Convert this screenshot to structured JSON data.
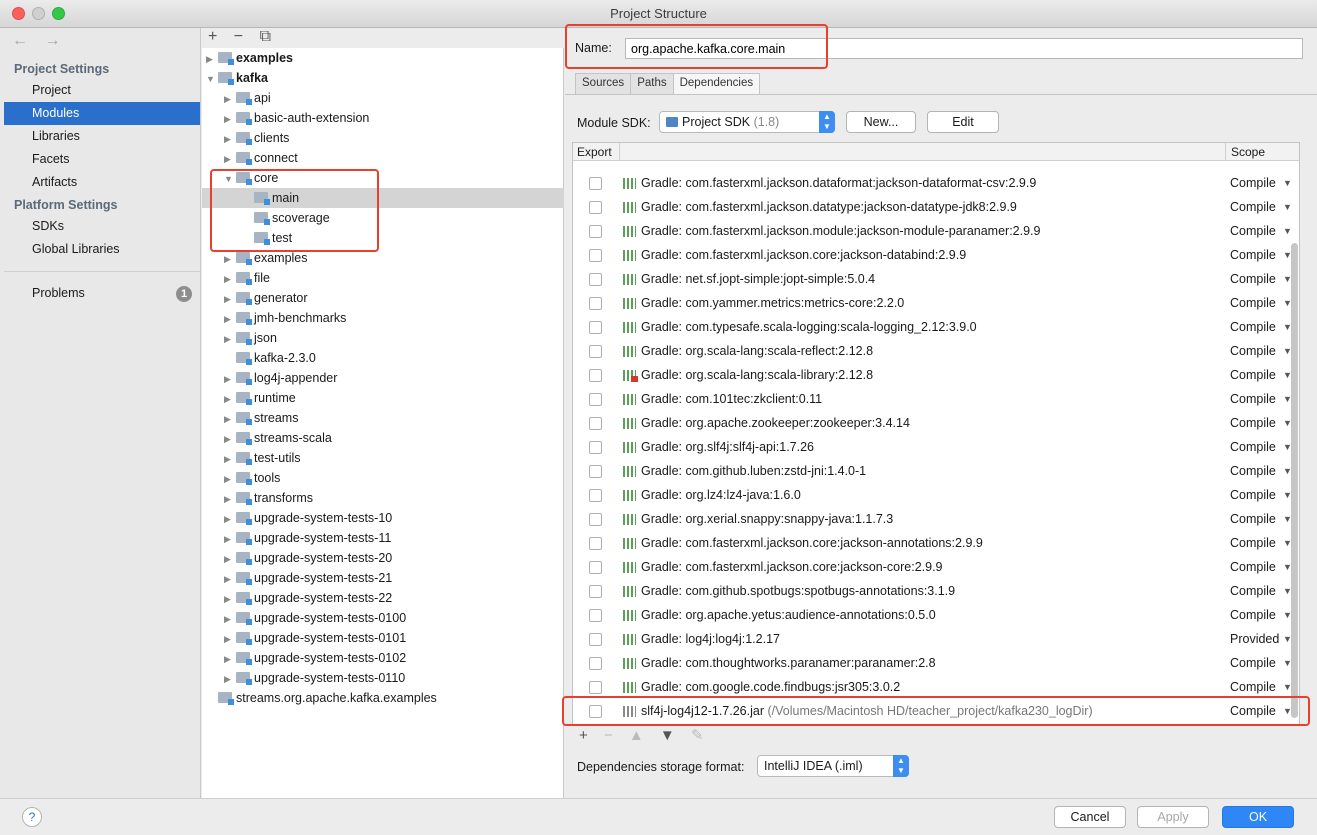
{
  "window": {
    "title": "Project Structure"
  },
  "nav": {
    "back": "←",
    "forward": "→",
    "project_settings": "Project Settings",
    "project_items": [
      "Project",
      "Modules",
      "Libraries",
      "Facets",
      "Artifacts"
    ],
    "platform_settings": "Platform Settings",
    "platform_items": [
      "SDKs",
      "Global Libraries"
    ],
    "problems": "Problems",
    "problems_count": "1"
  },
  "tree": {
    "toolbar": [
      "+",
      "−",
      "⧉"
    ],
    "items": [
      {
        "label": "examples",
        "arrow": "▶",
        "bold": true
      },
      {
        "label": "kafka",
        "arrow": "▼",
        "bold": true
      },
      {
        "label": "api",
        "arrow": "▶"
      },
      {
        "label": "basic-auth-extension",
        "arrow": "▶"
      },
      {
        "label": "clients",
        "arrow": "▶"
      },
      {
        "label": "connect",
        "arrow": "▶"
      },
      {
        "label": "core",
        "arrow": "▼"
      },
      {
        "label": "main",
        "arrow": ""
      },
      {
        "label": "scoverage",
        "arrow": ""
      },
      {
        "label": "test",
        "arrow": ""
      },
      {
        "label": "examples",
        "arrow": "▶"
      },
      {
        "label": "file",
        "arrow": "▶"
      },
      {
        "label": "generator",
        "arrow": "▶"
      },
      {
        "label": "jmh-benchmarks",
        "arrow": "▶"
      },
      {
        "label": "json",
        "arrow": "▶"
      },
      {
        "label": "kafka-2.3.0",
        "arrow": ""
      },
      {
        "label": "log4j-appender",
        "arrow": "▶"
      },
      {
        "label": "runtime",
        "arrow": "▶"
      },
      {
        "label": "streams",
        "arrow": "▶"
      },
      {
        "label": "streams-scala",
        "arrow": "▶"
      },
      {
        "label": "test-utils",
        "arrow": "▶"
      },
      {
        "label": "tools",
        "arrow": "▶"
      },
      {
        "label": "transforms",
        "arrow": "▶"
      },
      {
        "label": "upgrade-system-tests-10",
        "arrow": "▶"
      },
      {
        "label": "upgrade-system-tests-11",
        "arrow": "▶"
      },
      {
        "label": "upgrade-system-tests-20",
        "arrow": "▶"
      },
      {
        "label": "upgrade-system-tests-21",
        "arrow": "▶"
      },
      {
        "label": "upgrade-system-tests-22",
        "arrow": "▶"
      },
      {
        "label": "upgrade-system-tests-0100",
        "arrow": "▶"
      },
      {
        "label": "upgrade-system-tests-0101",
        "arrow": "▶"
      },
      {
        "label": "upgrade-system-tests-0102",
        "arrow": "▶"
      },
      {
        "label": "upgrade-system-tests-0110",
        "arrow": "▶"
      },
      {
        "label": "streams.org.apache.kafka.examples",
        "arrow": ""
      }
    ]
  },
  "module": {
    "name_label": "Name:",
    "name_value": "org.apache.kafka.core.main",
    "tabs": [
      "Sources",
      "Paths",
      "Dependencies"
    ],
    "sdk_label": "Module SDK:",
    "sdk_value": "Project SDK",
    "sdk_version": "(1.8)",
    "new_button": "New...",
    "edit_button": "Edit"
  },
  "deps": {
    "col_export": "Export",
    "col_scope": "Scope",
    "rows": [
      {
        "name": "Gradle: com.fasterxml.jackson.dataformat:jackson-dataformat-csv:2.9.9",
        "scope": "Compile"
      },
      {
        "name": "Gradle: com.fasterxml.jackson.datatype:jackson-datatype-jdk8:2.9.9",
        "scope": "Compile"
      },
      {
        "name": "Gradle: com.fasterxml.jackson.module:jackson-module-paranamer:2.9.9",
        "scope": "Compile"
      },
      {
        "name": "Gradle: com.fasterxml.jackson.core:jackson-databind:2.9.9",
        "scope": "Compile"
      },
      {
        "name": "Gradle: net.sf.jopt-simple:jopt-simple:5.0.4",
        "scope": "Compile"
      },
      {
        "name": "Gradle: com.yammer.metrics:metrics-core:2.2.0",
        "scope": "Compile"
      },
      {
        "name": "Gradle: com.typesafe.scala-logging:scala-logging_2.12:3.9.0",
        "scope": "Compile"
      },
      {
        "name": "Gradle: org.scala-lang:scala-reflect:2.12.8",
        "scope": "Compile"
      },
      {
        "name": "Gradle: org.scala-lang:scala-library:2.12.8",
        "scope": "Compile",
        "red": true
      },
      {
        "name": "Gradle: com.101tec:zkclient:0.11",
        "scope": "Compile"
      },
      {
        "name": "Gradle: org.apache.zookeeper:zookeeper:3.4.14",
        "scope": "Compile"
      },
      {
        "name": "Gradle: org.slf4j:slf4j-api:1.7.26",
        "scope": "Compile"
      },
      {
        "name": "Gradle: com.github.luben:zstd-jni:1.4.0-1",
        "scope": "Compile"
      },
      {
        "name": "Gradle: org.lz4:lz4-java:1.6.0",
        "scope": "Compile"
      },
      {
        "name": "Gradle: org.xerial.snappy:snappy-java:1.1.7.3",
        "scope": "Compile"
      },
      {
        "name": "Gradle: com.fasterxml.jackson.core:jackson-annotations:2.9.9",
        "scope": "Compile"
      },
      {
        "name": "Gradle: com.fasterxml.jackson.core:jackson-core:2.9.9",
        "scope": "Compile"
      },
      {
        "name": "Gradle: com.github.spotbugs:spotbugs-annotations:3.1.9",
        "scope": "Compile"
      },
      {
        "name": "Gradle: org.apache.yetus:audience-annotations:0.5.0",
        "scope": "Compile"
      },
      {
        "name": "Gradle: log4j:log4j:1.2.17",
        "scope": "Provided"
      },
      {
        "name": "Gradle: com.thoughtworks.paranamer:paranamer:2.8",
        "scope": "Compile"
      },
      {
        "name": "Gradle: com.google.code.findbugs:jsr305:3.0.2",
        "scope": "Compile"
      },
      {
        "name": "slf4j-log4j12-1.7.26.jar",
        "path": "(/Volumes/Macintosh HD/teacher_project/kafka230_logDir)",
        "scope": "Compile",
        "jar": true
      }
    ],
    "tools": [
      "+",
      "−",
      "▲",
      "▼",
      "✎"
    ]
  },
  "storage": {
    "label": "Dependencies storage format:",
    "value": "IntelliJ IDEA (.iml)"
  },
  "footer": {
    "help": "?",
    "cancel": "Cancel",
    "apply": "Apply",
    "ok": "OK"
  },
  "colors": {
    "selection": "#2a6fcb",
    "highlight": "#e8402e",
    "ok_button": "#2f86f6"
  }
}
